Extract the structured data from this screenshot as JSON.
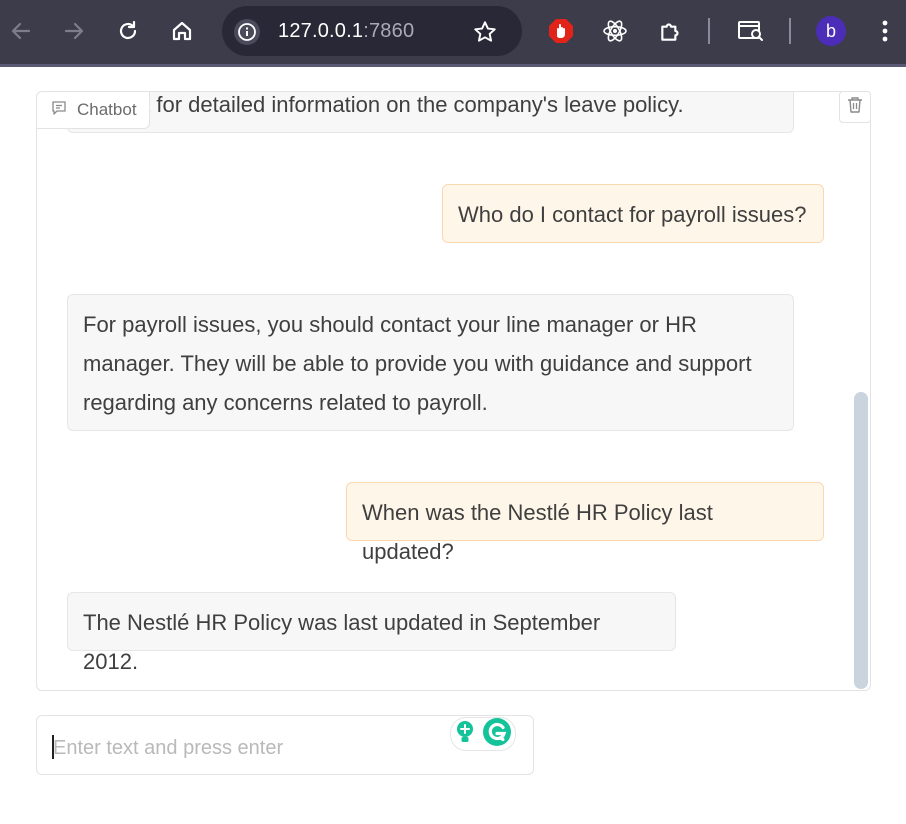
{
  "browser": {
    "url_host": "127.0.0.1",
    "url_port": ":7860",
    "profile_initial": "b"
  },
  "chatbot": {
    "label": "Chatbot",
    "messages": [
      {
        "role": "bot",
        "text": "...ment for detailed information on the company's leave policy."
      },
      {
        "role": "user",
        "text": "Who do I contact for payroll issues?"
      },
      {
        "role": "bot",
        "text": "For payroll issues, you should contact your line manager or HR manager. They will be able to provide you with guidance and support regarding any concerns related to payroll."
      },
      {
        "role": "user",
        "text": "When was the Nestlé HR Policy last updated?"
      },
      {
        "role": "bot",
        "text": "The Nestlé HR Policy was last updated in September 2012."
      }
    ]
  },
  "input": {
    "placeholder": "Enter text and press enter",
    "value": ""
  },
  "colors": {
    "toolbar": "#3c3c4a",
    "user_bubble": "#fff6ea",
    "user_border": "#fbd9b0",
    "bot_bubble": "#f7f7f7",
    "avatar": "#4b2db8",
    "grammarly": "#15c39a"
  }
}
